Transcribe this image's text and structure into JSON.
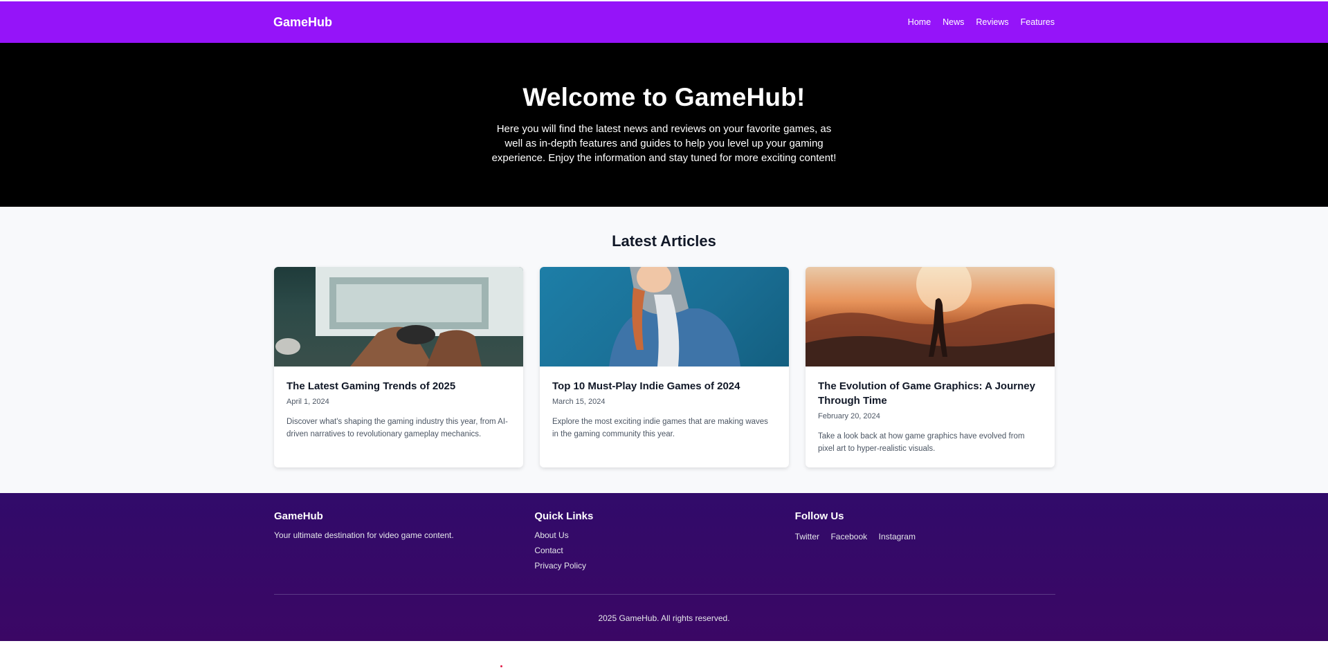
{
  "nav": {
    "brand": "GameHub",
    "links": [
      "Home",
      "News",
      "Reviews",
      "Features"
    ],
    "bg_color": "#9514f9"
  },
  "hero": {
    "title": "Welcome to GameHub!",
    "text": "Here you will find the latest news and reviews on your favorite games, as well as in-depth features and guides to help you level up your gaming experience. Enjoy the information and stay tuned for more exciting content!"
  },
  "articles": {
    "heading": "Latest Articles",
    "items": [
      {
        "title": "The Latest Gaming Trends of 2025",
        "date": "April 1, 2024",
        "desc": "Discover what's shaping the gaming industry this year, from AI-driven narratives to revolutionary gameplay mechanics."
      },
      {
        "title": "Top 10 Must-Play Indie Games of 2024",
        "date": "March 15, 2024",
        "desc": "Explore the most exciting indie games that are making waves in the gaming community this year."
      },
      {
        "title": "The Evolution of Game Graphics: A Journey Through Time",
        "date": "February 20, 2024",
        "desc": "Take a look back at how game graphics have evolved from pixel art to hyper-realistic visuals."
      }
    ]
  },
  "footer": {
    "about": {
      "title": "GameHub",
      "text": "Your ultimate destination for video game content."
    },
    "quick_links": {
      "title": "Quick Links",
      "links": [
        "About Us",
        "Contact",
        "Privacy Policy"
      ]
    },
    "follow": {
      "title": "Follow Us",
      "links": [
        "Twitter",
        "Facebook",
        "Instagram"
      ]
    },
    "copyright": "2025 GameHub. All rights reserved."
  }
}
